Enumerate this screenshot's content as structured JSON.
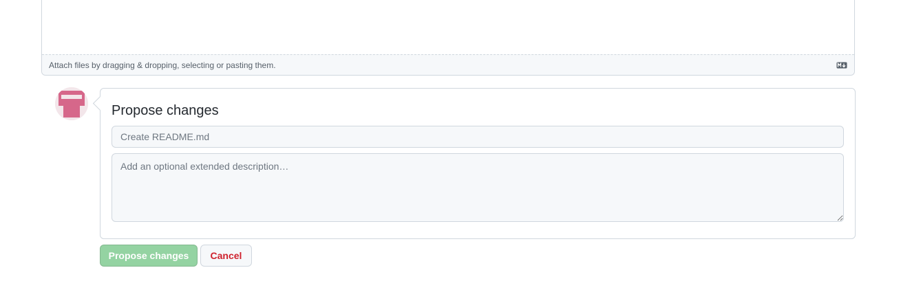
{
  "editor": {
    "attach_hint": "Attach files by dragging & dropping, selecting or pasting them.",
    "markdown_icon": "markdown-icon"
  },
  "avatar": {
    "icon": "identicon-avatar",
    "color": "#d6678a"
  },
  "commit": {
    "title": "Propose changes",
    "summary_placeholder": "Create README.md",
    "summary_value": "",
    "description_placeholder": "Add an optional extended description…",
    "description_value": ""
  },
  "actions": {
    "propose_label": "Propose changes",
    "cancel_label": "Cancel"
  },
  "colors": {
    "propose_disabled_bg": "#94d3a2",
    "cancel_text": "#cf222e",
    "border": "#d0d7de"
  }
}
